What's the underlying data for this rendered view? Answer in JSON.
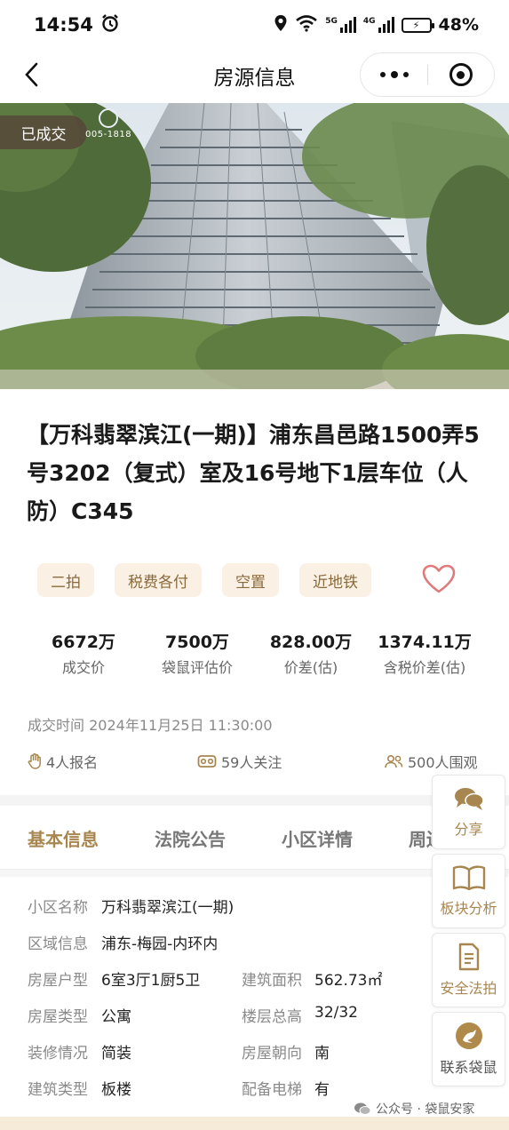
{
  "status_bar": {
    "time": "14:54",
    "net_5g": "5G",
    "net_4g": "4G",
    "battery": "48%"
  },
  "header": {
    "title": "房源信息",
    "back_icon": "back-arrow-icon",
    "more_icon": "more-dots-icon",
    "close_icon": "target-close-icon"
  },
  "photo": {
    "badge": "已成交",
    "logo_text": "005-1818"
  },
  "listing": {
    "title": "【万科翡翠滨江(一期)】浦东昌邑路1500弄5号3202（复式）室及16号地下1层车位（人防）C345"
  },
  "tags": [
    "二拍",
    "税费各付",
    "空置",
    "近地铁"
  ],
  "stats": [
    {
      "value": "6672万",
      "label": "成交价"
    },
    {
      "value": "7500万",
      "label": "袋鼠评估价"
    },
    {
      "value": "828.00万",
      "label": "价差(估)"
    },
    {
      "value": "1374.11万",
      "label": "含税价差(估)"
    }
  ],
  "deal_time": {
    "label": "成交时间",
    "value": "2024年11月25日 11:30:00"
  },
  "interest": {
    "signups": "4人报名",
    "follows": "59人关注",
    "watchers": "500人围观"
  },
  "tabs": [
    "基本信息",
    "法院公告",
    "小区详情",
    "周边"
  ],
  "info": {
    "community_label": "小区名称",
    "community": "万科翡翠滨江(一期)",
    "district_label": "区域信息",
    "district": "浦东-梅园-内环内",
    "layout_label": "房屋户型",
    "layout": "6室3厅1厨5卫",
    "area_label": "建筑面积",
    "area": "562.73㎡",
    "type_label": "房屋类型",
    "type": "公寓",
    "floors_label": "楼层总高",
    "floors": "32/32",
    "decor_label": "装修情况",
    "decor": "简装",
    "orientation_label": "房屋朝向",
    "orientation": "南",
    "structure_label": "建筑类型",
    "structure": "板楼",
    "elevator_label": "配备电梯",
    "elevator": "有"
  },
  "side_panel": {
    "share": "分享",
    "block_analysis": "板块分析",
    "safe_auction": "安全法拍",
    "contact": "联系袋鼠"
  },
  "watermark": "公众号 · 袋鼠安家",
  "colors": {
    "accent_gold": "#a8864f",
    "tag_bg": "#faf1e4",
    "favorite_red": "#e07a7a"
  }
}
